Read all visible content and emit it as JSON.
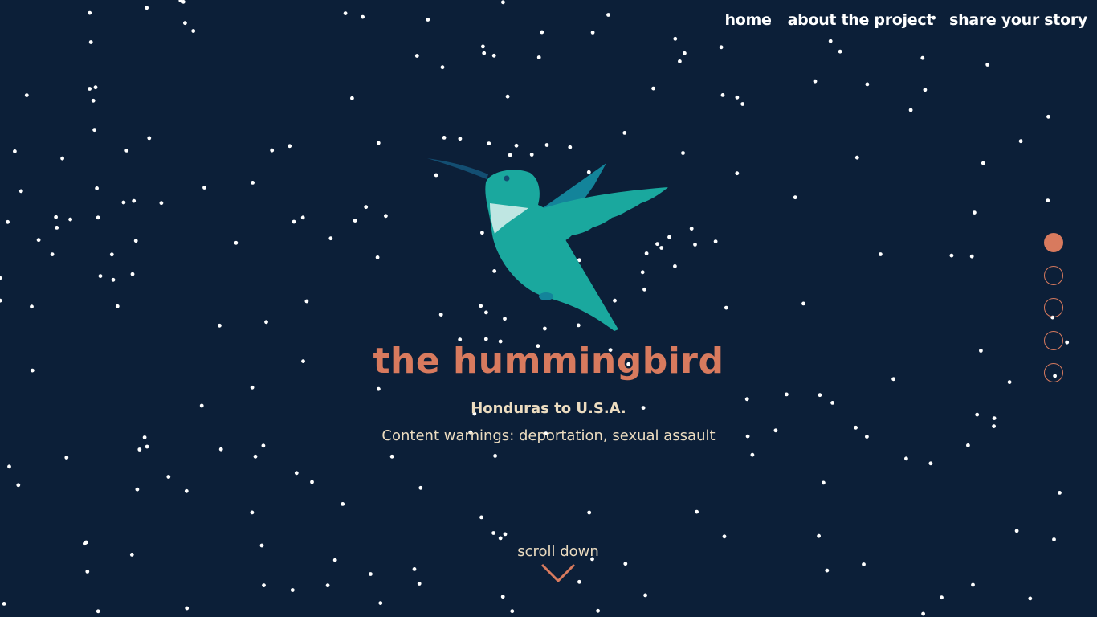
{
  "nav": {
    "home": "home",
    "about": "about the project",
    "share": "share your story"
  },
  "story": {
    "title": "the hummingbird",
    "route": "Honduras to U.S.A.",
    "warnings": "Content warnings: deportation, sexual assault"
  },
  "scroll": {
    "label": "scroll down",
    "icon": "chevron-down-icon"
  },
  "section_dots": {
    "count": 5,
    "active_index": 0
  },
  "colors": {
    "background": "#0c1f38",
    "accent": "#d87a5e",
    "text_light": "#ecdcc0",
    "nav_text": "#ffffff",
    "bird_body": "#1aa89e",
    "bird_wing_back": "#13849a",
    "bird_throat": "#bfe6e2",
    "stars": "#ffffff"
  }
}
